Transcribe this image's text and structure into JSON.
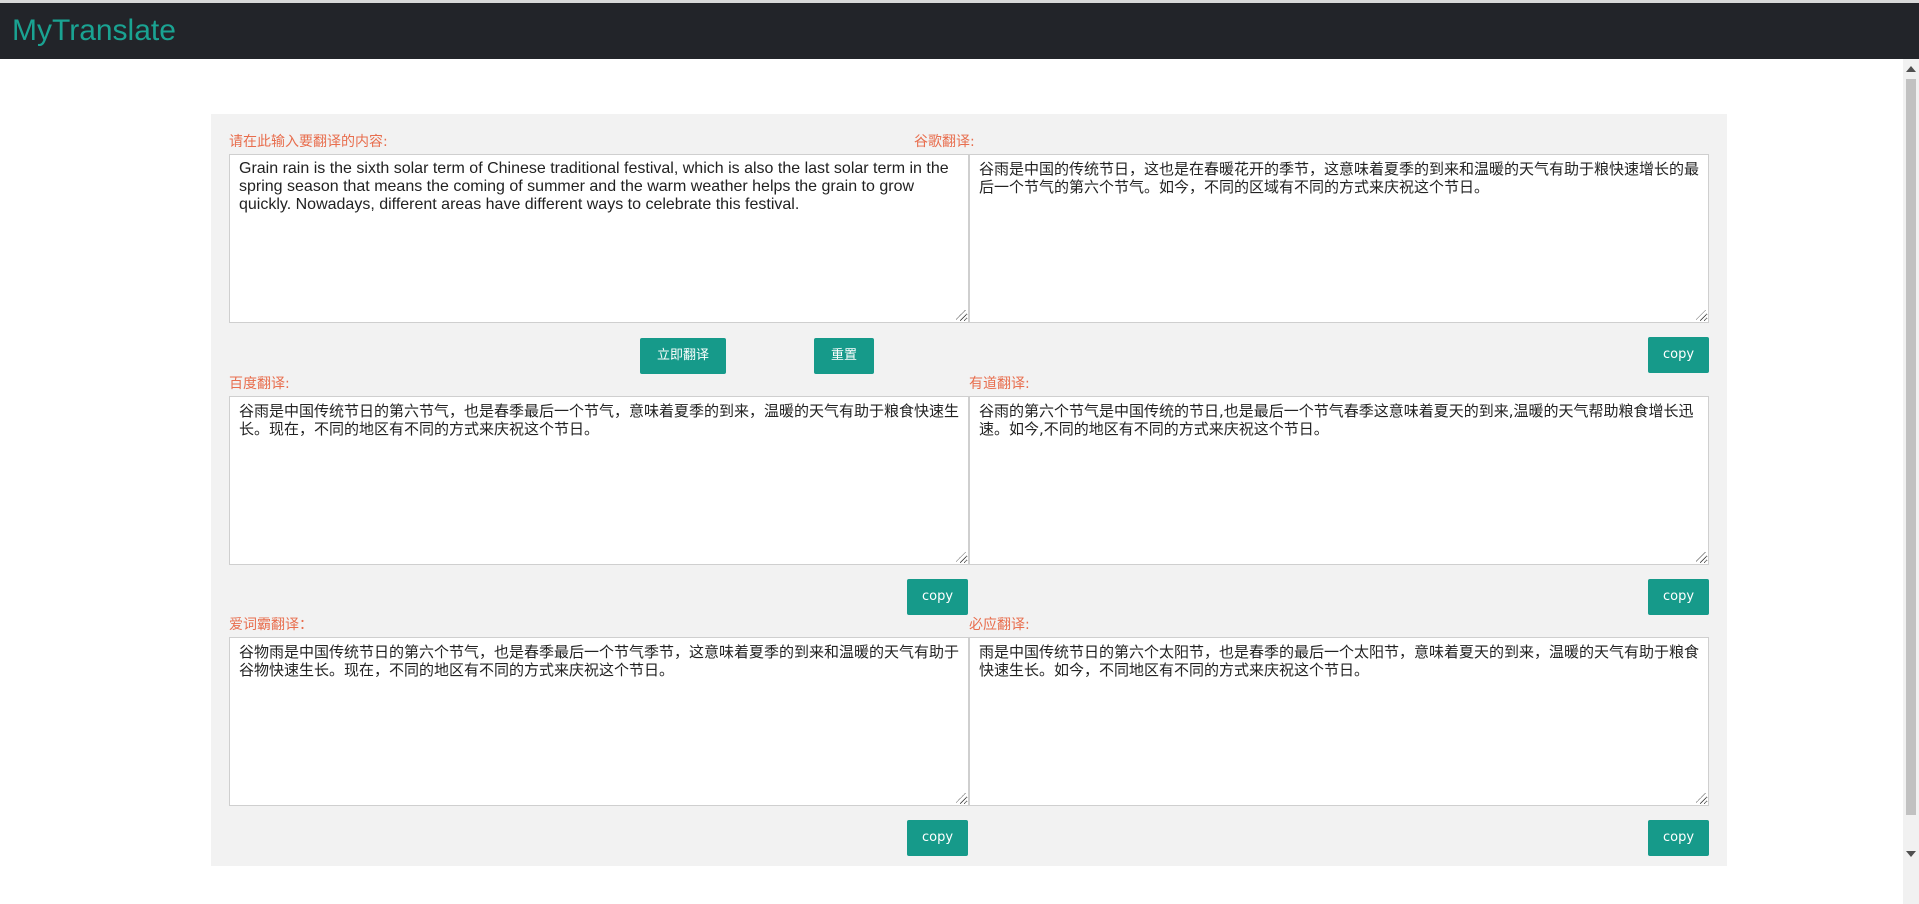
{
  "header": {
    "title": "MyTranslate"
  },
  "input": {
    "label": "请在此输入要翻译的内容:",
    "value": "Grain rain is the sixth solar term of Chinese traditional festival, which is also the last solar term in the spring season that means the coming of summer and the warm weather helps the grain to grow quickly. Nowadays, different areas have different ways to celebrate this festival."
  },
  "actions": {
    "translate_label": "立即翻译",
    "reset_label": "重置"
  },
  "results": {
    "google": {
      "label": "谷歌翻译:",
      "text": "谷雨是中国的传统节日，这也是在春暖花开的季节，这意味着夏季的到来和温暖的天气有助于粮快速增长的最后一个节气的第六个节气。如今，不同的区域有不同的方式来庆祝这个节日。",
      "copy_label": "copy"
    },
    "baidu": {
      "label": "百度翻译:",
      "text": "谷雨是中国传统节日的第六节气，也是春季最后一个节气，意味着夏季的到来，温暖的天气有助于粮食快速生长。现在，不同的地区有不同的方式来庆祝这个节日。",
      "copy_label": "copy"
    },
    "youdao": {
      "label": "有道翻译:",
      "text": "谷雨的第六个节气是中国传统的节日,也是最后一个节气春季这意味着夏天的到来,温暖的天气帮助粮食增长迅速。如今,不同的地区有不同的方式来庆祝这个节日。",
      "copy_label": "copy"
    },
    "iciba": {
      "label": "爱词霸翻译：",
      "text": "谷物雨是中国传统节日的第六个节气，也是春季最后一个节气季节，这意味着夏季的到来和温暖的天气有助于谷物快速生长。现在，不同的地区有不同的方式来庆祝这个节日。",
      "copy_label": "copy"
    },
    "bing": {
      "label": "必应翻译:",
      "text": "雨是中国传统节日的第六个太阳节，也是春季的最后一个太阳节，意味着夏天的到来，温暖的天气有助于粮食快速生长。如今，不同地区有不同的方式来庆祝这个节日。",
      "copy_label": "copy"
    }
  },
  "colors": {
    "accent": "#169a8a",
    "label": "#e86e4e",
    "header_bg": "#222429",
    "brand": "#1aa392"
  }
}
